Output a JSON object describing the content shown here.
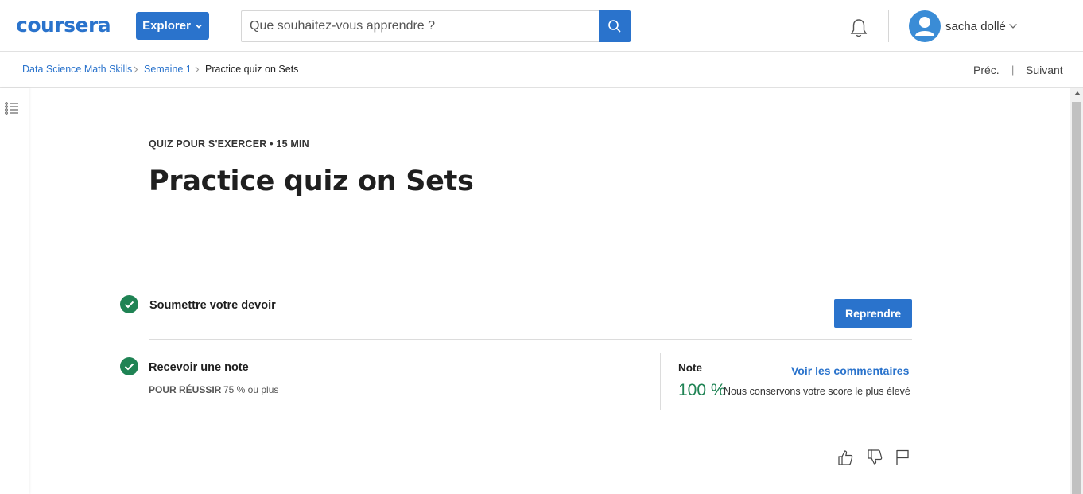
{
  "header": {
    "logo": "coursera",
    "explore_label": "Explorer",
    "search_placeholder": "Que souhaitez-vous apprendre ?",
    "username": "sacha dollé",
    "icons": [
      "chevron-down-icon",
      "search-icon",
      "bell-icon",
      "user-avatar",
      "chevron-down-icon"
    ]
  },
  "breadcrumb": {
    "items": [
      "Data Science Math Skills",
      "Semaine 1",
      "Practice quiz on Sets"
    ],
    "prev_label": "Préc.",
    "separator": "|",
    "next_label": "Suivant"
  },
  "quiz": {
    "type_label": "QUIZ POUR S'EXERCER",
    "bullet": "•",
    "duration": "15  MIN",
    "title": "Practice quiz on Sets"
  },
  "steps": {
    "submit_label": "Soumettre votre devoir",
    "resume_button": "Reprendre",
    "grade_label": "Recevoir une note",
    "pass_label": "POUR RÉUSSIR",
    "pass_value": "75 % ou plus"
  },
  "grade": {
    "note_label": "Note",
    "feedback_link": "Voir les commentaires",
    "score": "100 %",
    "score_note": "Nous conservons votre score le plus élevé"
  },
  "colors": {
    "brand": "#2a73cc",
    "success": "#1f8354"
  }
}
